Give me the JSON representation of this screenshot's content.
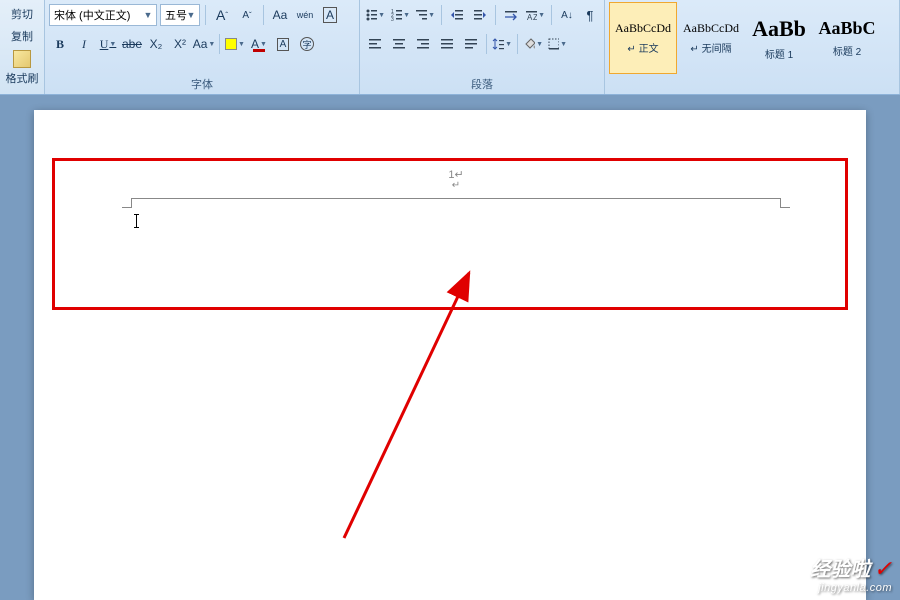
{
  "clipboard": {
    "cut_label": "剪切",
    "copy_label": "复制",
    "format_painter_label": "格式刷"
  },
  "font": {
    "group_title": "字体",
    "font_name": "宋体 (中文正文)",
    "font_size": "五号",
    "grow_font": "A",
    "shrink_font": "A",
    "clear_format": "Aa",
    "phonetic": "wén",
    "char_border": "A",
    "bold": "B",
    "italic": "I",
    "underline": "U",
    "strike": "abe",
    "subscript": "X₂",
    "superscript": "X²",
    "change_case": "Aa",
    "highlight": "ab",
    "font_color": "A"
  },
  "paragraph": {
    "group_title": "段落"
  },
  "styles": {
    "items": [
      {
        "preview": "AaBbCcDd",
        "label": "↵ 正文",
        "size": "12px",
        "selected": true
      },
      {
        "preview": "AaBbCcDd",
        "label": "↵ 无间隔",
        "size": "12px",
        "selected": false
      },
      {
        "preview": "AaBb",
        "label": "标题 1",
        "size": "22px",
        "selected": false
      },
      {
        "preview": "AaBbC",
        "label": "标题 2",
        "size": "18px",
        "selected": false
      }
    ]
  },
  "document": {
    "page_number": "1↵",
    "para_mark": "↵"
  },
  "watermark": {
    "brand": "经验啦",
    "check": "✓",
    "url": "jingyanla.com"
  }
}
